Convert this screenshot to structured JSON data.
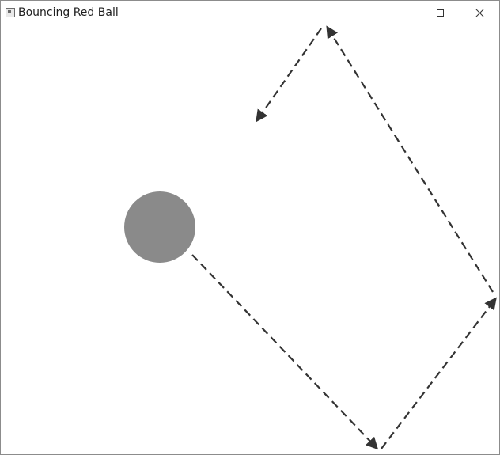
{
  "window": {
    "title": "Bouncing Red Ball",
    "controls": {
      "minimize": "minimize-icon",
      "maximize": "maximize-icon",
      "close": "close-icon"
    }
  },
  "canvas": {
    "ball_color": "#8a8a8a",
    "path_color": "#333333"
  }
}
